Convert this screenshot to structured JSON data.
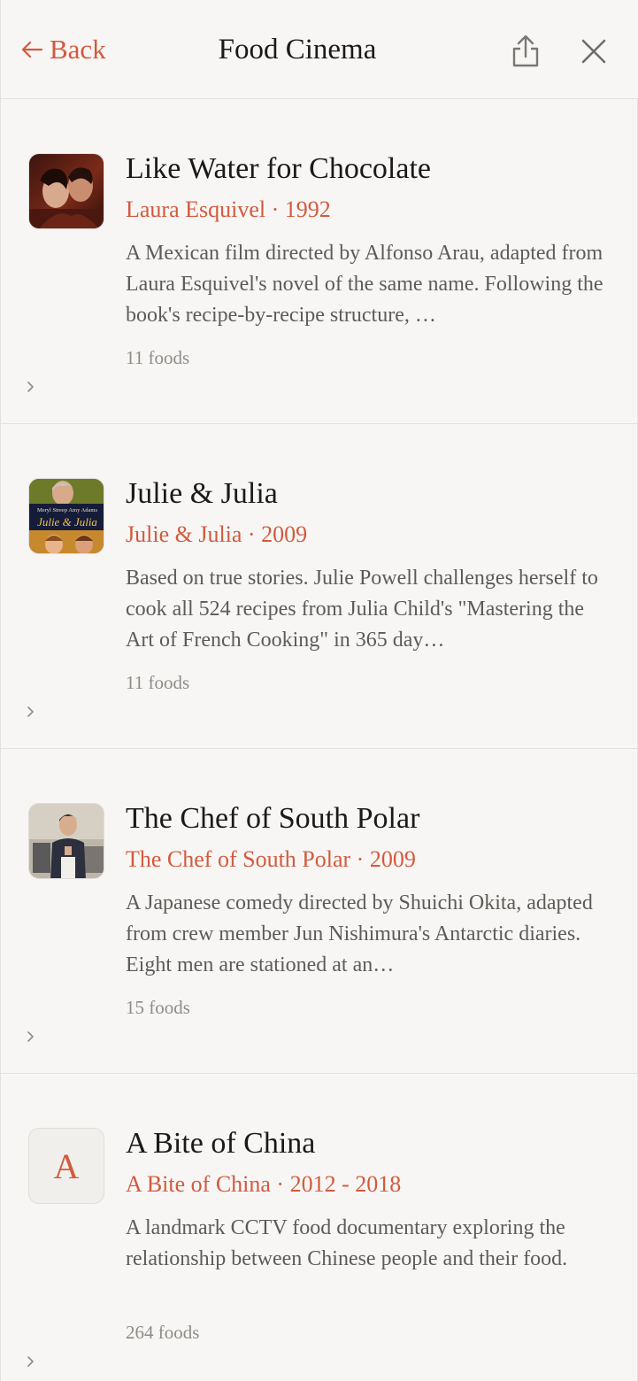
{
  "header": {
    "back_label": "Back",
    "title": "Food Cinema",
    "icons": {
      "share": "share-icon",
      "close": "close-icon"
    }
  },
  "colors": {
    "accent": "#d35a3e",
    "background": "#f7f6f4",
    "divider": "#e3e1de"
  },
  "items": [
    {
      "title": "Like Water for Chocolate",
      "subtitle": "Laura Esquivel · 1992",
      "description": "A Mexican film directed by Alfonso Arau, adapted from Laura Esquivel's novel of the same name. Following the book's recipe-by-recipe structure, …",
      "count": "11 foods",
      "thumb": "poster"
    },
    {
      "title": "Julie & Julia",
      "subtitle": "Julie & Julia · 2009",
      "description": "Based on true stories. Julie Powell challenges herself to cook all 524 recipes from Julia Child's \"Mastering the Art of French Cooking\" in 365 day…",
      "count": "11 foods",
      "thumb": "poster",
      "poster_text": {
        "names": "Meryl Streep Amy Adams",
        "title": "Julie & Julia"
      }
    },
    {
      "title": "The Chef of South Polar",
      "subtitle": "The Chef of South Polar · 2009",
      "description": "A Japanese comedy directed by Shuichi Okita, adapted from crew member Jun Nishimura's Antarctic diaries. Eight men are stationed at an…",
      "count": "15 foods",
      "thumb": "poster"
    },
    {
      "title": "A Bite of China",
      "subtitle": "A Bite of China · 2012 - 2018",
      "description": "A landmark CCTV food documentary exploring the relationship between Chinese people and their food.",
      "count": "264 foods",
      "thumb": "letter",
      "thumb_letter": "A"
    }
  ]
}
